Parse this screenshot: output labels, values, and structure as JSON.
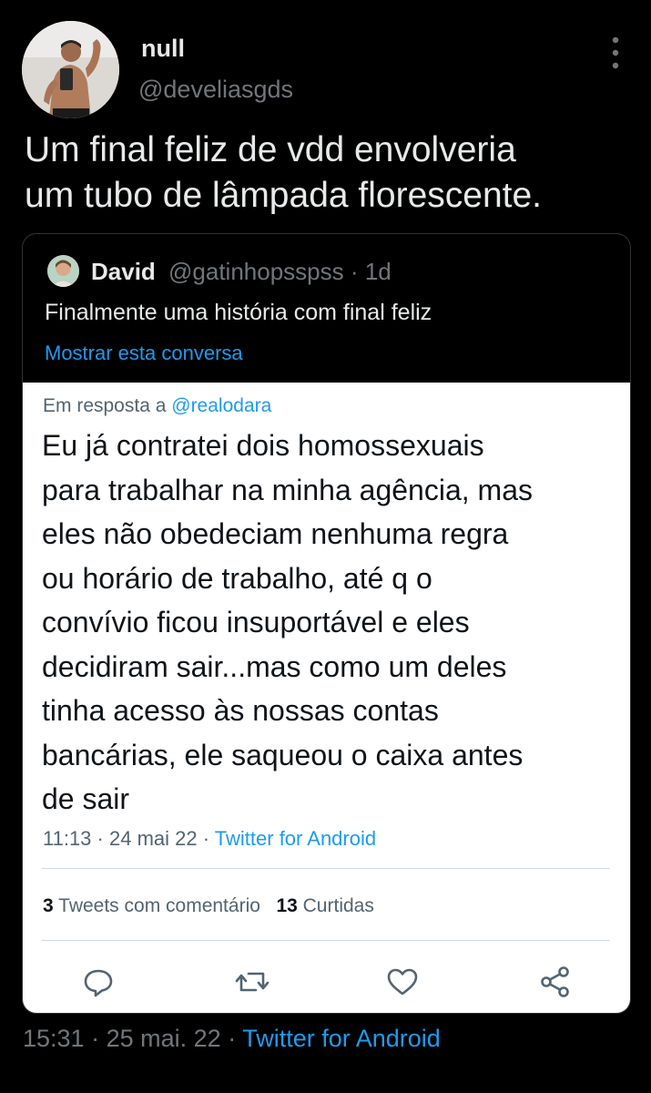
{
  "tweet": {
    "display_name": "null",
    "handle": "@develiasgds",
    "text_lines": [
      "Um final feliz de vdd envolveria",
      "um tubo de lâmpada florescente."
    ],
    "time": "15:31",
    "date": "25 mai. 22",
    "separator": "·",
    "source": "Twitter for Android"
  },
  "quote": {
    "display_name": "David",
    "handle": "@gatinhopsspss",
    "age": "1d",
    "separator": "·",
    "text": "Finalmente uma história com final feliz",
    "show_thread": "Mostrar esta conversa"
  },
  "screenshot": {
    "reply_prefix": "Em resposta a",
    "reply_mention": "@realodara",
    "text_lines": [
      "Eu já contratei dois homossexuais",
      "para trabalhar na minha agência, mas",
      "eles não obedeciam nenhuma regra",
      "ou horário de trabalho, até q o",
      "convívio ficou insuportável e eles",
      "decidiram sair...mas como um deles",
      "tinha acesso às nossas contas",
      "bancárias, ele saqueou o caixa antes",
      "de sair"
    ],
    "time": "11:13",
    "date": "24 mai 22",
    "separator": "·",
    "source": "Twitter for Android",
    "quote_count": "3",
    "quote_label": "Tweets com comentário",
    "like_count": "13",
    "like_label": "Curtidas"
  },
  "colors": {
    "background": "#000000",
    "accent": "#1d9bf0",
    "secondary_text": "#71767b",
    "card_background": "#ffffff"
  },
  "icons": {
    "more": "more-vertical-icon",
    "reply": "reply-icon",
    "retweet": "retweet-icon",
    "like": "like-icon",
    "share": "share-icon"
  }
}
